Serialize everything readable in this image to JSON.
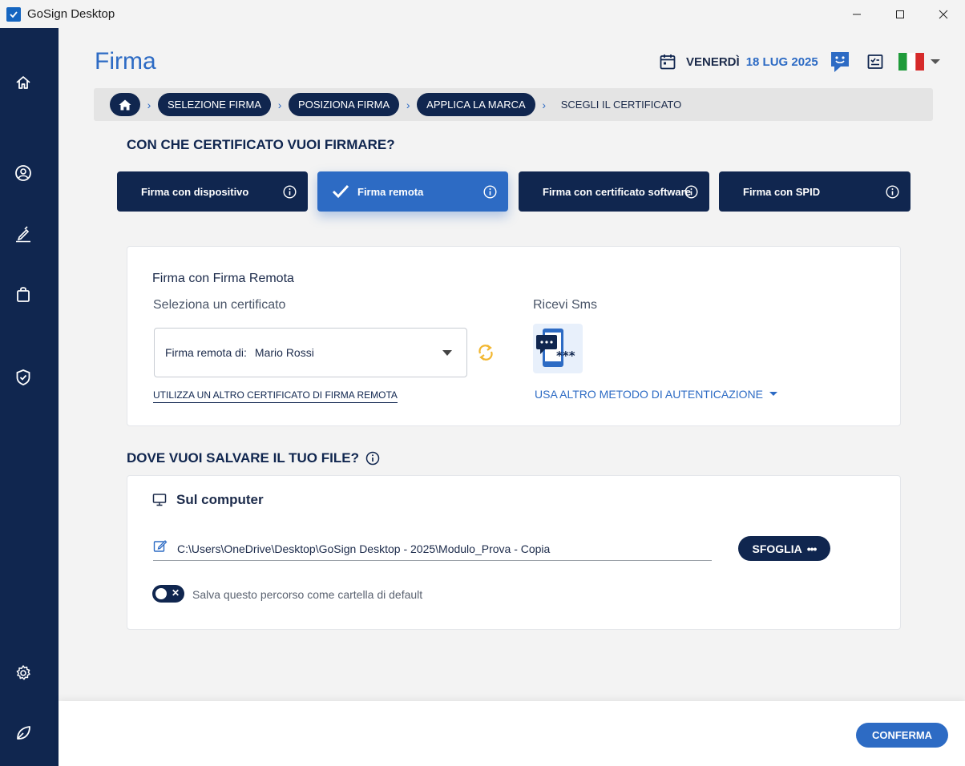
{
  "window": {
    "title": "GoSign Desktop",
    "controls": [
      "minimize",
      "maximize",
      "close"
    ]
  },
  "sidebar": {
    "items": [
      {
        "name": "home",
        "icon": "home-icon"
      },
      {
        "name": "profile",
        "icon": "user-circle-icon"
      },
      {
        "name": "sign",
        "icon": "pen-sign-icon"
      },
      {
        "name": "shopping",
        "icon": "shopping-bag-icon"
      },
      {
        "name": "security",
        "icon": "shield-check-icon"
      },
      {
        "name": "settings",
        "icon": "gear-icon"
      },
      {
        "name": "eco",
        "icon": "leaf-icon"
      }
    ]
  },
  "header": {
    "title": "Firma",
    "date_day": "VENERDÌ",
    "date_value": "18 LUG 2025",
    "icons": [
      "calendar-icon",
      "assistant-chat-icon",
      "checklist-icon",
      "italy-flag-icon",
      "dropdown-caret-icon"
    ]
  },
  "breadcrumb": {
    "steps": [
      "SELEZIONE FIRMA",
      "POSIZIONA FIRMA",
      "APPLICA LA MARCA"
    ],
    "current": "SCEGLI IL CERTIFICATO"
  },
  "certificate_section": {
    "title": "CON CHE CERTIFICATO VUOI FIRMARE?",
    "methods": [
      {
        "label": "Firma con dispositivo",
        "active": false
      },
      {
        "label": "Firma remota",
        "active": true
      },
      {
        "label": "Firma con certificato software",
        "active": false
      },
      {
        "label": "Firma con SPID",
        "active": false
      }
    ]
  },
  "remote_card": {
    "heading": "Firma con Firma Remota",
    "select_label": "Seleziona un certificato",
    "select_prefix": "Firma remota di:",
    "select_value": "Mario Rossi",
    "alt_cert_link": "UTILIZZA UN ALTRO CERTIFICATO DI FIRMA REMOTA",
    "sms_label": "Ricevi Sms",
    "alt_auth_link": "USA ALTRO METODO DI AUTENTICAZIONE"
  },
  "save_section": {
    "title": "DOVE VUOI SALVARE IL TUO FILE?",
    "location_heading": "Sul computer",
    "path": "C:\\Users\\OneDrive\\Desktop\\GoSign Desktop - 2025\\Modulo_Prova - Copia",
    "browse_label": "SFOGLIA",
    "default_toggle_label": "Salva questo percorso come cartella di default",
    "default_toggle_on": false
  },
  "footer": {
    "confirm_label": "CONFERMA"
  },
  "colors": {
    "sidebar": "#10264f",
    "accent": "#2d6bc4",
    "dark_button": "#10264f",
    "sync_icon": "#f2b731"
  }
}
